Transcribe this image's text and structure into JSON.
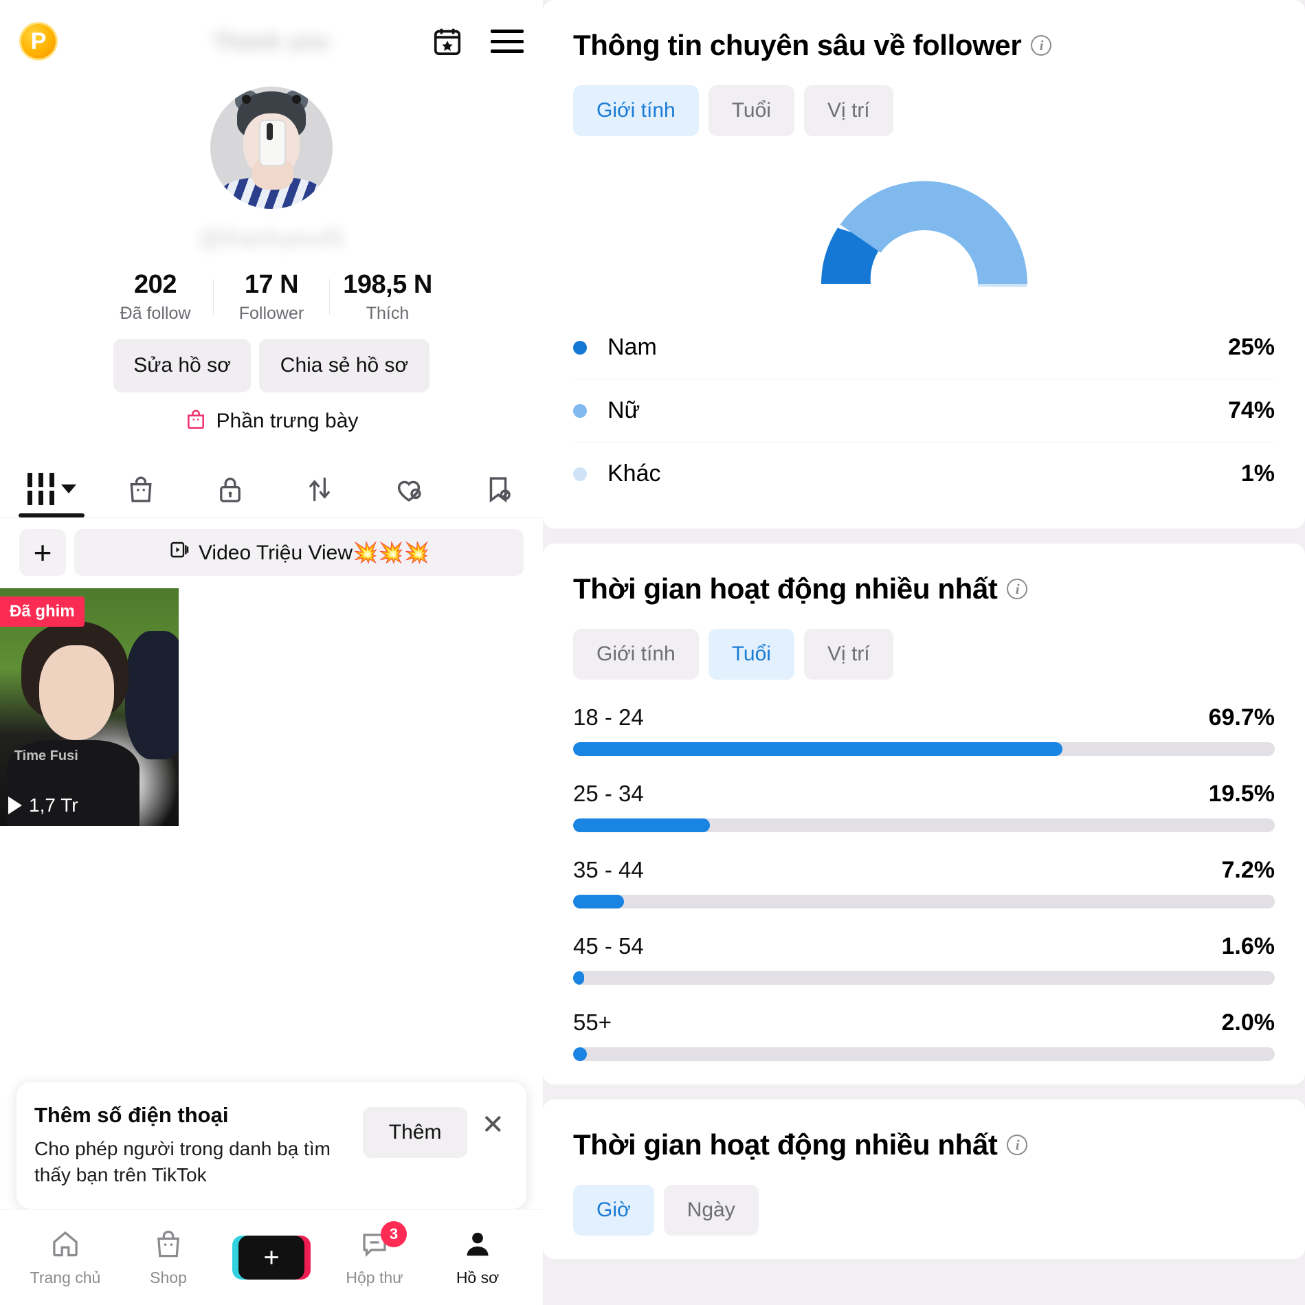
{
  "profile": {
    "badge_letter": "P",
    "blurred_title": "Thank you",
    "blurred_handle": "@thanhyeu45",
    "icons": {
      "calendar_star": "calendar-star-icon",
      "menu": "hamburger-menu-icon"
    },
    "stats": [
      {
        "num": "202",
        "label": "Đã follow"
      },
      {
        "num": "17 N",
        "label": "Follower"
      },
      {
        "num": "198,5 N",
        "label": "Thích"
      }
    ],
    "edit_button": "Sửa hồ sơ",
    "share_button": "Chia sẻ hồ sơ",
    "showcase_label": "Phần trưng bày",
    "tabs": [
      {
        "name": "videos",
        "icon": "grid-bars-icon",
        "active": true
      },
      {
        "name": "shop",
        "icon": "shopping-bag-icon",
        "active": false
      },
      {
        "name": "private",
        "icon": "lock-icon",
        "active": false
      },
      {
        "name": "reposts",
        "icon": "repost-arrows-icon",
        "active": false
      },
      {
        "name": "liked",
        "icon": "heart-hidden-icon",
        "active": false
      },
      {
        "name": "saved",
        "icon": "bookmark-hidden-icon",
        "active": false
      }
    ],
    "add_playlist": "+",
    "playlist_label": "Video Triệu View💥💥💥",
    "playlist_icon": "video-playlist-icon",
    "pinned_badge": "Đã ghim",
    "video_views": "1,7 Tr",
    "video_overlay_text": "Time Fusi"
  },
  "promo": {
    "title": "Thêm số điện thoại",
    "subtitle": "Cho phép người trong danh bạ tìm thấy bạn trên TikTok",
    "action": "Thêm",
    "close": "✕"
  },
  "bottom_nav": [
    {
      "label": "Trang chủ",
      "icon": "home-icon",
      "active": false
    },
    {
      "label": "Shop",
      "icon": "shop-bag-icon",
      "active": false
    },
    {
      "label": "",
      "icon": "create-plus-icon",
      "active": false
    },
    {
      "label": "Hộp thư",
      "icon": "inbox-message-icon",
      "active": false,
      "badge": "3"
    },
    {
      "label": "Hồ sơ",
      "icon": "profile-person-icon",
      "active": true
    }
  ],
  "analytics": {
    "follower_insights": {
      "title": "Thông tin chuyên sâu về follower",
      "info_icon": "info-icon",
      "segments": [
        {
          "label": "Giới tính",
          "active": true
        },
        {
          "label": "Tuổi",
          "active": false
        },
        {
          "label": "Vị trí",
          "active": false
        }
      ]
    },
    "most_active_age": {
      "title": "Thời gian hoạt động nhiều nhất",
      "info_icon": "info-icon",
      "segments": [
        {
          "label": "Giới tính",
          "active": false
        },
        {
          "label": "Tuổi",
          "active": true
        },
        {
          "label": "Vị trí",
          "active": false
        }
      ]
    },
    "most_active_time": {
      "title": "Thời gian hoạt động nhiều nhất",
      "info_icon": "info-icon",
      "segments": [
        {
          "label": "Giờ",
          "active": true
        },
        {
          "label": "Ngày",
          "active": false
        }
      ]
    }
  },
  "chart_data": [
    {
      "type": "pie",
      "title": "Thông tin chuyên sâu về follower",
      "subtitle": "Giới tính",
      "style": "semicircle-donut-gauge",
      "categories": [
        "Nam",
        "Nữ",
        "Khác"
      ],
      "values": [
        25,
        74,
        1
      ],
      "labels": [
        "25%",
        "74%",
        "1%"
      ],
      "colors": [
        "#1478d4",
        "#7fb9ee",
        "#cfe3f7"
      ],
      "legend": "below"
    },
    {
      "type": "bar",
      "title": "Thời gian hoạt động nhiều nhất",
      "subtitle": "Tuổi",
      "orientation": "horizontal",
      "categories": [
        "18 - 24",
        "25 - 34",
        "35 - 44",
        "45 - 54",
        "55+"
      ],
      "values": [
        69.7,
        19.5,
        7.2,
        1.6,
        2.0
      ],
      "labels": [
        "69.7%",
        "19.5%",
        "7.2%",
        "1.6%",
        "2.0%"
      ],
      "xlim": [
        0,
        100
      ],
      "ylabel": "",
      "xlabel": "",
      "grid": false,
      "bar_color": "#1a84e2",
      "track_color": "#e2e0e4"
    }
  ]
}
